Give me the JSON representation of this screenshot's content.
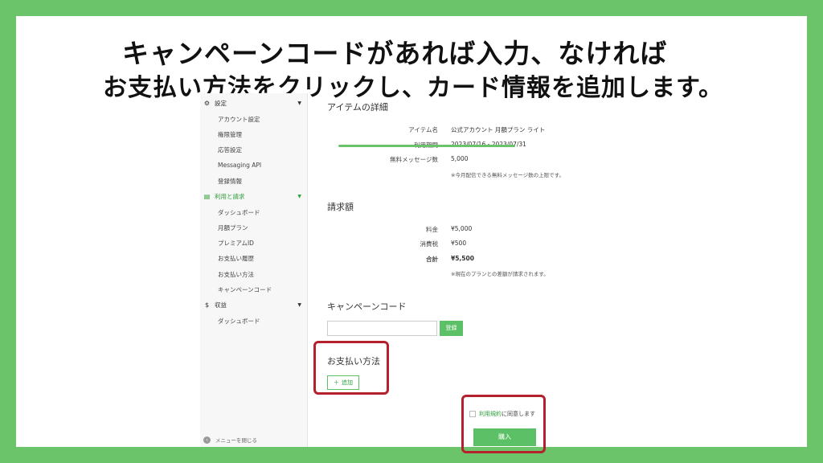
{
  "headline": {
    "line1": "キャンペーンコードがあれば入力、なければ",
    "line2": "お支払い方法をクリックし、カード情報を追加します。"
  },
  "sidebar": {
    "settings": {
      "label": "設定",
      "icon": "gear-icon"
    },
    "settings_items": [
      "アカウント設定",
      "権限管理",
      "応答設定",
      "Messaging API",
      "登録情報"
    ],
    "billing": {
      "label": "利用と請求",
      "icon": "document-icon"
    },
    "billing_items": [
      "ダッシュボード",
      "月額プラン",
      "プレミアムID",
      "お支払い履歴",
      "お支払い方法",
      "キャンペーンコード"
    ],
    "revenue": {
      "label": "収益",
      "icon": "dollar-icon"
    },
    "revenue_items": [
      "ダッシュボード"
    ],
    "footer": "メニューを閉じる"
  },
  "item_details": {
    "title": "アイテムの詳細",
    "rows": [
      {
        "label": "アイテム名",
        "value": "公式アカウント 月額プラン ライト"
      },
      {
        "label": "利用期間",
        "value": "2023/07/16 - 2023/07/31"
      },
      {
        "label": "無料メッセージ数",
        "value": "5,000"
      }
    ],
    "note": "※今月配信できる無料メッセージ数の上限です。"
  },
  "billing_amount": {
    "title": "請求額",
    "rows": [
      {
        "label": "料金",
        "value": "¥5,000"
      },
      {
        "label": "消費税",
        "value": "¥500"
      },
      {
        "label": "合計",
        "value": "¥5,500"
      }
    ],
    "note": "※現在のプランとの差額が請求されます。"
  },
  "campaign": {
    "title": "キャンペーンコード",
    "input_value": "",
    "button": "登録"
  },
  "payment": {
    "title": "お支払い方法",
    "add_button": "追加"
  },
  "agree": {
    "link": "利用規約",
    "text": "に同意します"
  },
  "purchase_button": "購入",
  "colors": {
    "frame": "#6cc46a",
    "accent": "#5cc066",
    "highlight": "#b5202e"
  }
}
